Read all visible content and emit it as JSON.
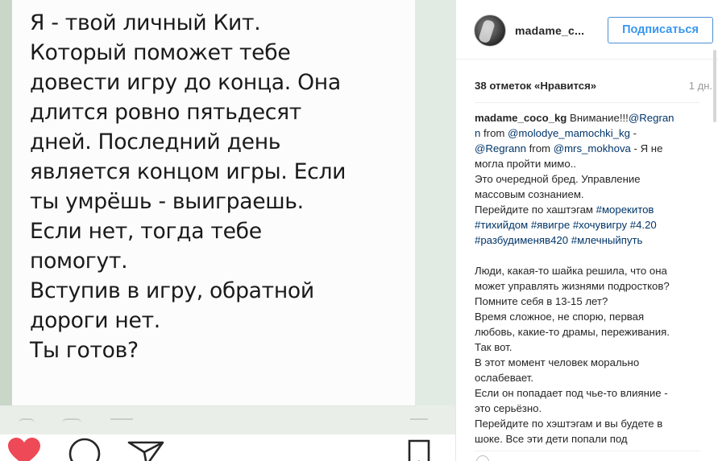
{
  "photo": {
    "lines": [
      "Я - твой личный Кит.",
      "Который поможет тебе",
      "довести игру до конца. Она",
      "длится ровно пятьдесят",
      "дней. Последний день",
      "является концом игры. Если",
      "ты умрёшь - выиграешь.",
      "Если нет, тогда тебе",
      "помогут.",
      "Вступив в игру, обратной",
      "дороги нет.",
      "Ты готов?"
    ]
  },
  "actions": {
    "like_icon": "heart-filled-icon",
    "comment_icon": "comment-icon",
    "share_icon": "send-icon",
    "save_icon": "bookmark-icon",
    "like_color": "#ed4956"
  },
  "header": {
    "username": "madame_c...",
    "follow_label": "Подписаться"
  },
  "post": {
    "likes": "38 отметок «Нравится»",
    "time": "1 дн."
  },
  "caption": {
    "l1_user": "madame_coco_kg",
    "l1_text": " Внимание!!!",
    "l1_mention": "@Regran",
    "l2_mention": "n",
    "l2_from": " from ",
    "l2_mention2": "@molodye_mamochki_kg",
    "l2_end": " -",
    "l3_mention": "@Regrann",
    "l3_from": " from ",
    "l3_mention2": "@mrs_mokhova",
    "l3_end": " - Я не",
    "l4": "могла пройти мимо..",
    "l5": "Это очередной бред. Управление",
    "l6": "массовым сознанием.",
    "l7_text": "Перейдите по хаштэгам ",
    "l7_tag": "#морекитов",
    "l8": "#тихийдом #явигре #хочувигру #4.20",
    "l9": "#разбудименяв420 #млечныйпуть",
    "l10": "Люди, какая-то шайка решила, что она",
    "l11": "может управлять жизнями подростков?",
    "l12": "Помните себя в 13-15 лет?",
    "l13": "Время сложное, не спорю, первая",
    "l14": "любовь, какие-то драмы, переживания.",
    "l15": "Так вот.",
    "l16": "В этот момент человек морально",
    "l17": "ослабевает.",
    "l18": "Если он попадает под чье-то влияние -",
    "l19": "это серьёзно.",
    "l20": "Перейдите по хэштэгам и вы будете в",
    "l21": "шоке. Все эти дети попали под"
  }
}
